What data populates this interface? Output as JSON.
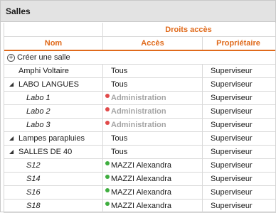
{
  "panel": {
    "title": "Salles"
  },
  "table": {
    "group_header": "Droits accès",
    "columns": {
      "name": "Nom",
      "access": "Accès",
      "owner": "Propriétaire"
    },
    "create_label": "Créer une salle",
    "rows": [
      {
        "name": "Amphi Voltaire",
        "access": "Tous",
        "owner": "Superviseur"
      },
      {
        "name": "LABO LANGUES",
        "access": "Tous",
        "owner": "Superviseur"
      },
      {
        "name": "Labo 1",
        "access": "Administration",
        "owner": "Superviseur"
      },
      {
        "name": "Labo 2",
        "access": "Administration",
        "owner": "Superviseur"
      },
      {
        "name": "Labo 3",
        "access": "Administration",
        "owner": "Superviseur"
      },
      {
        "name": "Lampes parapluies",
        "access": "Tous",
        "owner": "Superviseur"
      },
      {
        "name": "SALLES DE 40",
        "access": "Tous",
        "owner": "Superviseur"
      },
      {
        "name": "S12",
        "access": "MAZZI Alexandra",
        "owner": "Superviseur"
      },
      {
        "name": "S14",
        "access": "MAZZI Alexandra",
        "owner": "Superviseur"
      },
      {
        "name": "S16",
        "access": "MAZZI Alexandra",
        "owner": "Superviseur"
      },
      {
        "name": "S18",
        "access": "MAZZI Alexandra",
        "owner": "Superviseur"
      }
    ]
  },
  "colors": {
    "accent": "#e06a1b",
    "restricted": "#e14a4a",
    "granted": "#3fae3f",
    "disabled_text": "#a5a5a5"
  },
  "icons": {
    "create": "plus-circle-icon",
    "expand": "triangle-icon",
    "restricted": "red-dot-icon",
    "granted": "green-dot-icon"
  }
}
